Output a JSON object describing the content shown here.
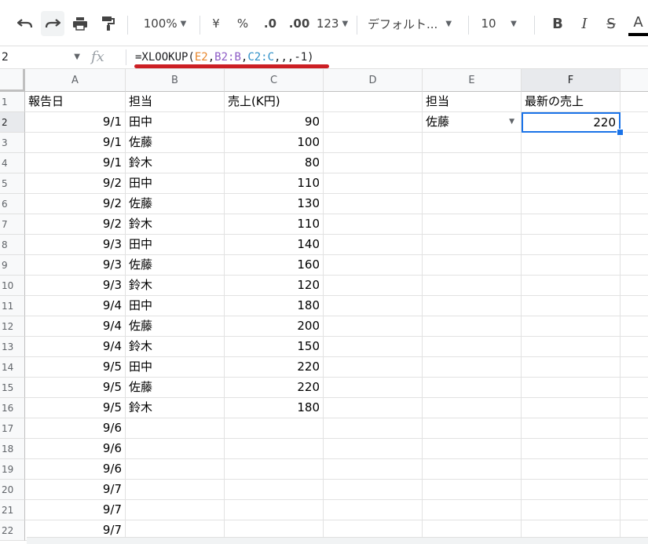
{
  "toolbar": {
    "zoom": "100%",
    "currency": "¥",
    "percent": "%",
    "decrease_decimal": ".0",
    "increase_decimal": ".00",
    "more_formats": "123",
    "font_name": "デフォルト...",
    "font_size": "10",
    "bold": "B",
    "italic": "I",
    "strike": "S",
    "text_color": "A"
  },
  "formula_bar": {
    "name_box": "2",
    "fx": "fx",
    "formula_parts": [
      "=XLOOKUP(",
      "E2",
      ",",
      "B2:B",
      ",",
      "C2:C",
      ",,,-1)"
    ]
  },
  "columns": [
    "A",
    "B",
    "C",
    "D",
    "E",
    "F"
  ],
  "rows": [
    {
      "n": "1",
      "a": "報告日",
      "b": "担当",
      "c": "売上(K円)",
      "e": "担当",
      "f": "最新の売上"
    },
    {
      "n": "2",
      "a": "9/1",
      "b": "田中",
      "c": "90",
      "e": "佐藤",
      "f": "220"
    },
    {
      "n": "3",
      "a": "9/1",
      "b": "佐藤",
      "c": "100"
    },
    {
      "n": "4",
      "a": "9/1",
      "b": "鈴木",
      "c": "80"
    },
    {
      "n": "5",
      "a": "9/2",
      "b": "田中",
      "c": "110"
    },
    {
      "n": "6",
      "a": "9/2",
      "b": "佐藤",
      "c": "130"
    },
    {
      "n": "7",
      "a": "9/2",
      "b": "鈴木",
      "c": "110"
    },
    {
      "n": "8",
      "a": "9/3",
      "b": "田中",
      "c": "140"
    },
    {
      "n": "9",
      "a": "9/3",
      "b": "佐藤",
      "c": "160"
    },
    {
      "n": "10",
      "a": "9/3",
      "b": "鈴木",
      "c": "120"
    },
    {
      "n": "11",
      "a": "9/4",
      "b": "田中",
      "c": "180"
    },
    {
      "n": "12",
      "a": "9/4",
      "b": "佐藤",
      "c": "200"
    },
    {
      "n": "13",
      "a": "9/4",
      "b": "鈴木",
      "c": "150"
    },
    {
      "n": "14",
      "a": "9/5",
      "b": "田中",
      "c": "220"
    },
    {
      "n": "15",
      "a": "9/5",
      "b": "佐藤",
      "c": "220"
    },
    {
      "n": "16",
      "a": "9/5",
      "b": "鈴木",
      "c": "180"
    },
    {
      "n": "17",
      "a": "9/6"
    },
    {
      "n": "18",
      "a": "9/6"
    },
    {
      "n": "19",
      "a": "9/6"
    },
    {
      "n": "20",
      "a": "9/7"
    },
    {
      "n": "21",
      "a": "9/7"
    },
    {
      "n": "22",
      "a": "9/7"
    }
  ],
  "colors": {
    "selection": "#1a73e8",
    "formula_underline": "#cc1f24"
  }
}
